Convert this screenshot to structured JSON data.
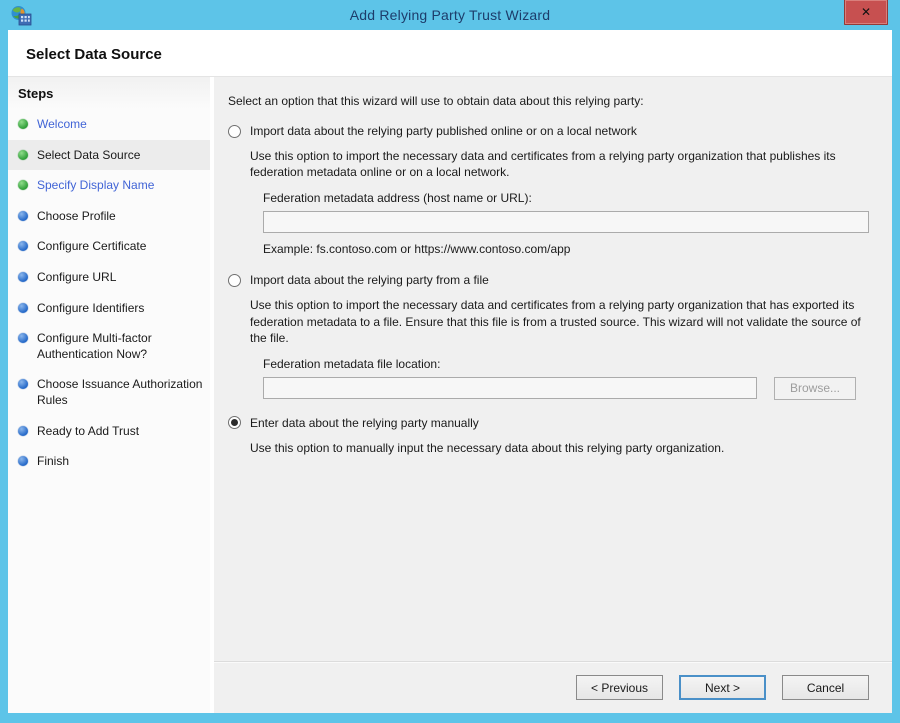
{
  "window": {
    "title": "Add Relying Party Trust Wizard",
    "close_label": "✕"
  },
  "header": {
    "title": "Select Data Source"
  },
  "sidebar": {
    "title": "Steps",
    "items": [
      {
        "label": "Welcome",
        "state": "visited",
        "bullet": "green"
      },
      {
        "label": "Select Data Source",
        "state": "current",
        "bullet": "green"
      },
      {
        "label": "Specify Display Name",
        "state": "visited",
        "bullet": "green"
      },
      {
        "label": "Choose Profile",
        "state": "future",
        "bullet": "blue"
      },
      {
        "label": "Configure Certificate",
        "state": "future",
        "bullet": "blue"
      },
      {
        "label": "Configure URL",
        "state": "future",
        "bullet": "blue"
      },
      {
        "label": "Configure Identifiers",
        "state": "future",
        "bullet": "blue"
      },
      {
        "label": "Configure Multi-factor Authentication Now?",
        "state": "future",
        "bullet": "blue"
      },
      {
        "label": "Choose Issuance Authorization Rules",
        "state": "future",
        "bullet": "blue"
      },
      {
        "label": "Ready to Add Trust",
        "state": "future",
        "bullet": "blue"
      },
      {
        "label": "Finish",
        "state": "future",
        "bullet": "blue"
      }
    ]
  },
  "content": {
    "intro": "Select an option that this wizard will use to obtain data about this relying party:",
    "options": [
      {
        "label": "Import data about the relying party published online or on a local network",
        "selected": false,
        "description": "Use this option to import the necessary data and certificates from a relying party organization that publishes its federation metadata online or on a local network.",
        "field_label": "Federation metadata address (host name or URL):",
        "field_value": "",
        "example": "Example: fs.contoso.com or https://www.contoso.com/app"
      },
      {
        "label": "Import data about the relying party from a file",
        "selected": false,
        "description": "Use this option to import the necessary data and certificates from a relying party organization that has exported its federation metadata to a file. Ensure that this file is from a trusted source.  This wizard will not validate the source of the file.",
        "field_label": "Federation metadata file location:",
        "field_value": "",
        "browse_label": "Browse..."
      },
      {
        "label": "Enter data about the relying party manually",
        "selected": true,
        "description": "Use this option to manually input the necessary data about this relying party organization."
      }
    ]
  },
  "footer": {
    "previous_label": "< Previous",
    "next_label": "Next >",
    "cancel_label": "Cancel"
  },
  "colors": {
    "titlebar": "#5dc4e8",
    "title_text": "#1d3d6b",
    "close_button": "#c75050",
    "content_bg": "#f0f0f0",
    "link_blue": "#4164d6",
    "bullet_green": "#2f9e38",
    "bullet_blue": "#2468c8",
    "next_button_border": "#4a90c8"
  }
}
